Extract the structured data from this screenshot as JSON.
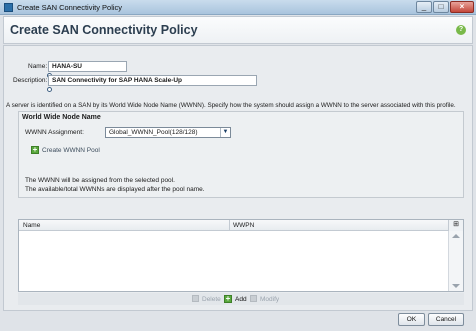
{
  "window": {
    "title": "Create SAN Connectivity Policy",
    "background_tabs": [
      "",
      "",
      ""
    ]
  },
  "header": {
    "page_title": "Create SAN Connectivity Policy"
  },
  "form": {
    "name_label": "Name:",
    "name_value": "HANA-SU",
    "description_label": "Description:",
    "description_value": "SAN Connectivity for SAP HANA Scale-Up",
    "help_text": "A server is identified on a SAN by its World Wide Node Name (WWNN). Specify how the system should assign a WWNN to the server associated with this profile."
  },
  "wwnn_group": {
    "title": "World Wide Node Name",
    "assignment_label": "WWNN Assignment:",
    "assignment_value": "Global_WWNN_Pool(128/128)",
    "create_pool_label": "Create WWNN Pool",
    "note_line1": "The WWNN will be assigned from the selected pool.",
    "note_line2": "The available/total WWNNs are displayed after the pool name."
  },
  "table": {
    "columns": [
      "Name",
      "WWPN"
    ],
    "rows": []
  },
  "table_toolbar": {
    "delete_label": "Delete",
    "add_label": "Add",
    "modify_label": "Modify"
  },
  "footer": {
    "ok_label": "OK",
    "cancel_label": "Cancel"
  },
  "colors": {
    "accent": "#2c3e50",
    "add_green": "#59a83c"
  }
}
